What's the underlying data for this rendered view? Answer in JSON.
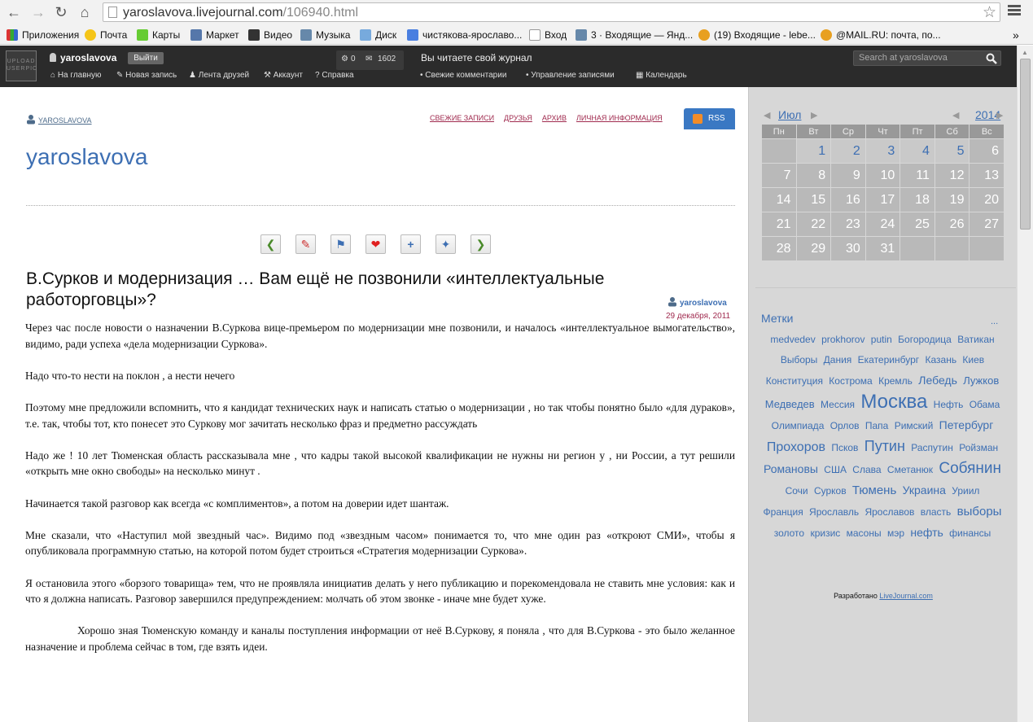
{
  "browser": {
    "url_host": "yaroslavova.livejournal.com",
    "url_path": "/106940.html",
    "bookmarks": [
      "Приложения",
      "Почта",
      "Карты",
      "Маркет",
      "Видео",
      "Музыка",
      "Диск",
      "чистякова-ярославо...",
      "Вход",
      "3 · Входящие — Янд...",
      "(19) Входящие - lebe...",
      "@MAIL.RU: почта, по..."
    ],
    "bookmarks_more": "»"
  },
  "ljbar": {
    "userpic_text": "UPLOAD USERPIC",
    "username": "yaroslavova",
    "logout": "Выйти",
    "count_a": "0",
    "count_b": "1602",
    "nav": [
      "На главную",
      "Новая запись",
      "Лента друзей",
      "Аккаунт",
      "Справка"
    ],
    "reading": "Вы читаете свой журнал",
    "nav2": [
      "Свежие комментарии",
      "Управление записями",
      "Календарь"
    ],
    "search_placeholder": "Search at yaroslavova"
  },
  "journal": {
    "user": "YAROSLAVOVA",
    "nav": [
      "СВЕЖИЕ ЗАПИСИ",
      "ДРУЗЬЯ",
      "АРХИВ",
      "ЛИЧНАЯ ИНФОРМАЦИЯ"
    ],
    "rss": "RSS",
    "title": "yaroslavova"
  },
  "post": {
    "title": "В.Сурков и модернизация … Вам ещё не позвонили «интеллектуальные работорговцы»?",
    "author": "yaroslavova",
    "date": "29 декабря, 2011",
    "paragraphs": [
      "Через час   после  новости о назначении В.Суркова  вице-премьером по модернизации    мне  позвонили,    и   началось «интеллектуальное  вымогательство»,  видимо,  ради  успеха «дела    модернизации   Суркова».",
      "Надо что-то нести на  поклон ,   а нести нечего",
      "Поэтому  мне  предложили  вспомнить,     что я кандидат  технических наук  и  написать   статью   о модернизации ,   но   так   чтобы   понятно было    «для  дураков», т.е.    так,   чтобы    тот, кто    понесет это Суркову   мог  зачитать    несколько фраз и  предметно рассуждать",
      "Надо же !     10 лет Тюменская область рассказывала мне , что кадры такой  высокой  квалификации не  нужны  ни регион у , ни России, а тут    решили «открыть мне окно свободы»   на несколько  минут .",
      "Начинается такой     разговор   как  всегда  «с комплиментов», а   потом на доверии  идет  шантаж.",
      "Мне  сказали,   что «Наступил мой звездный  час».   Видимо   под «звездным часом»    понимается   то, что  мне    один раз «откроют СМИ», чтобы    я опубликовала     программную     статью,   на  которой    потом будет строиться «Стратегия модернизации  Суркова».",
      "Я      остановила этого «борзого   товарища» тем, что   не   проявляла     инициатив          делать   у него   публикацию и    порекомендовала   не ставить  мне  условия: как и что я  должна  написать.   Разговор  завершился  предупреждением:  молчать  об этом звонке    - иначе мне будет  хуже.",
      "Хорошо зная     Тюменскую  команду  и каналы  поступления информации   от неё   В.Суркову,     я поняла , что для В.Суркова - это было желанное назначение   и проблема   сейчас  в том, где   взять    идеи."
    ]
  },
  "calendar": {
    "month": "Июл",
    "year": "2014",
    "weekdays": [
      "Пн",
      "Вт",
      "Ср",
      "Чт",
      "Пт",
      "Сб",
      "Вс"
    ],
    "weeks": [
      [
        "",
        "1",
        "2",
        "3",
        "4",
        "5",
        "6"
      ],
      [
        "7",
        "8",
        "9",
        "10",
        "11",
        "12",
        "13"
      ],
      [
        "14",
        "15",
        "16",
        "17",
        "18",
        "19",
        "20"
      ],
      [
        "21",
        "22",
        "23",
        "24",
        "25",
        "26",
        "27"
      ],
      [
        "28",
        "29",
        "30",
        "31",
        "",
        "",
        ""
      ]
    ],
    "linked_days": [
      "1",
      "2",
      "3",
      "4",
      "5"
    ]
  },
  "tags": {
    "title": "Метки",
    "more": "...",
    "items": [
      {
        "t": "medvedev",
        "s": 12
      },
      {
        "t": "prokhorov",
        "s": 12
      },
      {
        "t": "putin",
        "s": 12
      },
      {
        "t": "Богородица",
        "s": 12
      },
      {
        "t": "Ватикан",
        "s": 12
      },
      {
        "t": "Выборы",
        "s": 12
      },
      {
        "t": "Дания",
        "s": 12
      },
      {
        "t": "Екатеринбург",
        "s": 12
      },
      {
        "t": "Казань",
        "s": 12
      },
      {
        "t": "Киев",
        "s": 12
      },
      {
        "t": "Конституция",
        "s": 12
      },
      {
        "t": "Кострома",
        "s": 12
      },
      {
        "t": "Кремль",
        "s": 12
      },
      {
        "t": "Лебедь",
        "s": 14
      },
      {
        "t": "Лужков",
        "s": 13
      },
      {
        "t": "Медведев",
        "s": 13
      },
      {
        "t": "Мессия",
        "s": 12
      },
      {
        "t": "Москва",
        "s": 24
      },
      {
        "t": "Нефть",
        "s": 12
      },
      {
        "t": "Обама",
        "s": 12
      },
      {
        "t": "Олимпиада",
        "s": 12
      },
      {
        "t": "Орлов",
        "s": 12
      },
      {
        "t": "Папа",
        "s": 12
      },
      {
        "t": "Римский",
        "s": 12
      },
      {
        "t": "Петербург",
        "s": 14
      },
      {
        "t": "Прохоров",
        "s": 16
      },
      {
        "t": "Псков",
        "s": 12
      },
      {
        "t": "Путин",
        "s": 18
      },
      {
        "t": "Распутин",
        "s": 12
      },
      {
        "t": "Ройзман",
        "s": 12
      },
      {
        "t": "Романовы",
        "s": 14
      },
      {
        "t": "США",
        "s": 12
      },
      {
        "t": "Слава",
        "s": 12
      },
      {
        "t": "Сметанюк",
        "s": 12
      },
      {
        "t": "Собянин",
        "s": 19
      },
      {
        "t": "Сочи",
        "s": 12
      },
      {
        "t": "Сурков",
        "s": 12
      },
      {
        "t": "Тюмень",
        "s": 15
      },
      {
        "t": "Украина",
        "s": 14
      },
      {
        "t": "Уриил",
        "s": 12
      },
      {
        "t": "Франция",
        "s": 12
      },
      {
        "t": "Ярославль",
        "s": 12
      },
      {
        "t": "Ярославов",
        "s": 12
      },
      {
        "t": "власть",
        "s": 12
      },
      {
        "t": "выборы",
        "s": 15
      },
      {
        "t": "золото",
        "s": 12
      },
      {
        "t": "кризис",
        "s": 12
      },
      {
        "t": "масоны",
        "s": 12
      },
      {
        "t": "мэр",
        "s": 12
      },
      {
        "t": "нефть",
        "s": 14
      },
      {
        "t": "финансы",
        "s": 12
      }
    ]
  },
  "powered": {
    "prefix": "Разработано",
    "link": "LiveJournal.com"
  },
  "colors": {
    "accent": "#3d6fb3",
    "journal_nav": "#a02b4f",
    "ljbar": "#2b2b2b",
    "sidebar": "#d7d7d7"
  }
}
